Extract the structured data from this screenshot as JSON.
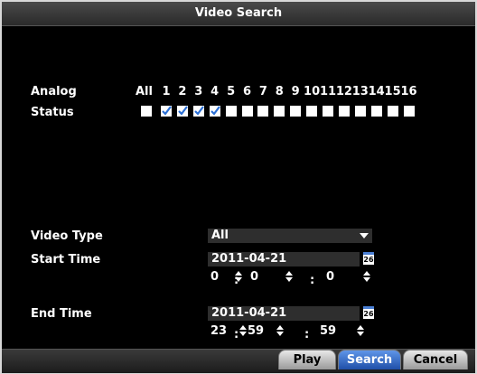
{
  "window": {
    "title": "Video Search"
  },
  "analog": {
    "label": "Analog",
    "status_label": "Status",
    "all_label": "All",
    "channels": [
      "1",
      "2",
      "3",
      "4",
      "5",
      "6",
      "7",
      "8",
      "9",
      "10",
      "11",
      "12",
      "13",
      "14",
      "15",
      "16"
    ],
    "checked": [
      true,
      true,
      true,
      true,
      false,
      false,
      false,
      false,
      false,
      false,
      false,
      false,
      false,
      false,
      false,
      false
    ],
    "all_checked": false
  },
  "video_type": {
    "label": "Video Type",
    "value": "All"
  },
  "start_time": {
    "label": "Start Time",
    "date": "2011-04-21",
    "hour": "0",
    "minute": "0",
    "second": "0"
  },
  "end_time": {
    "label": "End Time",
    "date": "2011-04-21",
    "hour": "23",
    "minute": "59",
    "second": "59"
  },
  "calendar_icon_text": {
    "month": "JULY",
    "day": "26"
  },
  "buttons": {
    "play": "Play",
    "search": "Search",
    "cancel": "Cancel"
  },
  "colors": {
    "accent": "#2f66c8",
    "check": "#2a6fd6",
    "background": "#000000"
  }
}
